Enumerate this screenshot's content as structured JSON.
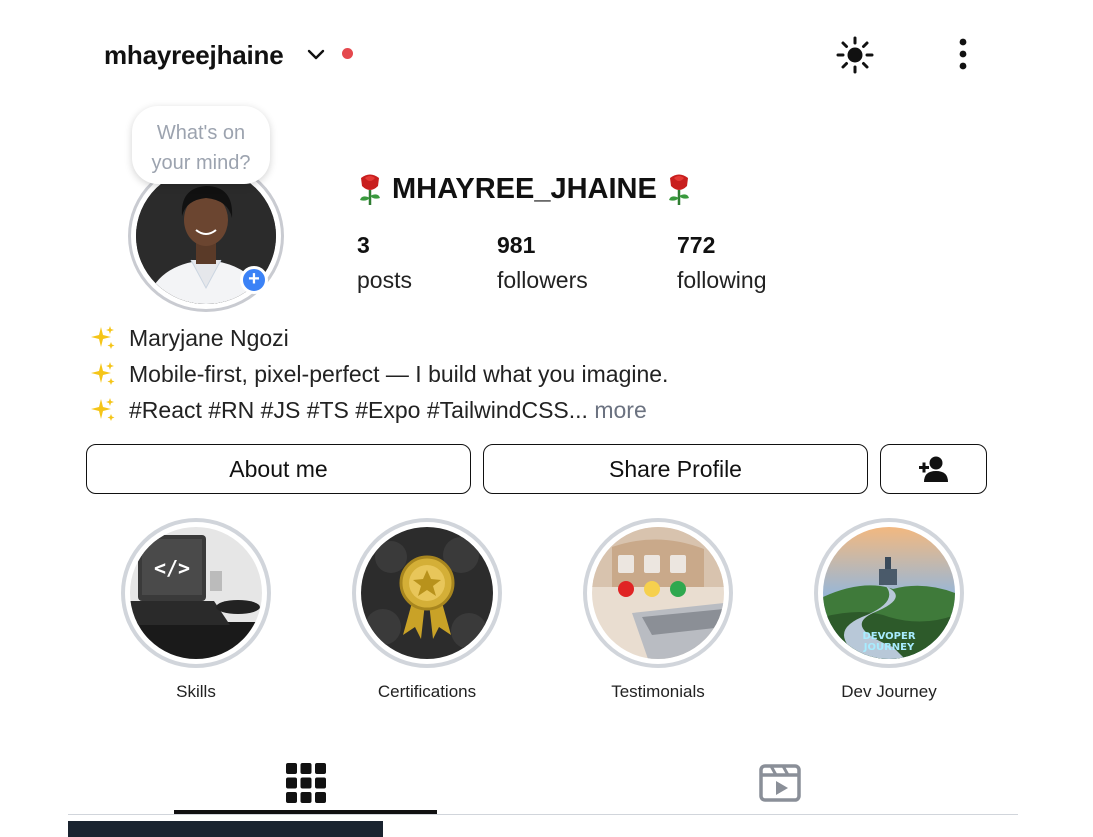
{
  "header": {
    "username": "mhayreejhaine",
    "icons": [
      "chevron-down-icon",
      "sun-icon",
      "more-vertical-icon"
    ],
    "status_dot_color": "#e5484d"
  },
  "note_bubble": {
    "line1": "What's on",
    "line2": "your mind?"
  },
  "profile": {
    "display_name": "MHAYREE_JHAINE",
    "avatar_badge": "+",
    "stats": [
      {
        "value": "3",
        "label": "posts"
      },
      {
        "value": "981",
        "label": "followers"
      },
      {
        "value": "772",
        "label": "following"
      }
    ]
  },
  "bio": {
    "lines": [
      "Maryjane Ngozi",
      "Mobile-first, pixel-perfect — I build what you imagine.",
      "#React #RN #JS #TS #Expo #TailwindCSS..."
    ],
    "more": "more"
  },
  "actions": {
    "about": "About me",
    "share": "Share Profile",
    "add_user_icon": "add-user-icon"
  },
  "highlights": [
    {
      "label": "Skills"
    },
    {
      "label": "Certifications"
    },
    {
      "label": "Testimonials"
    },
    {
      "label": "Dev Journey",
      "image_text_1": "DEVOPER",
      "image_text_2": "JOURNEY"
    }
  ],
  "tabs": [
    {
      "icon": "grid-icon",
      "active": true
    },
    {
      "icon": "reels-icon",
      "active": false
    }
  ],
  "colors": {
    "accent": "#3b82f6",
    "text": "#111111",
    "muted": "#9ca3af"
  }
}
